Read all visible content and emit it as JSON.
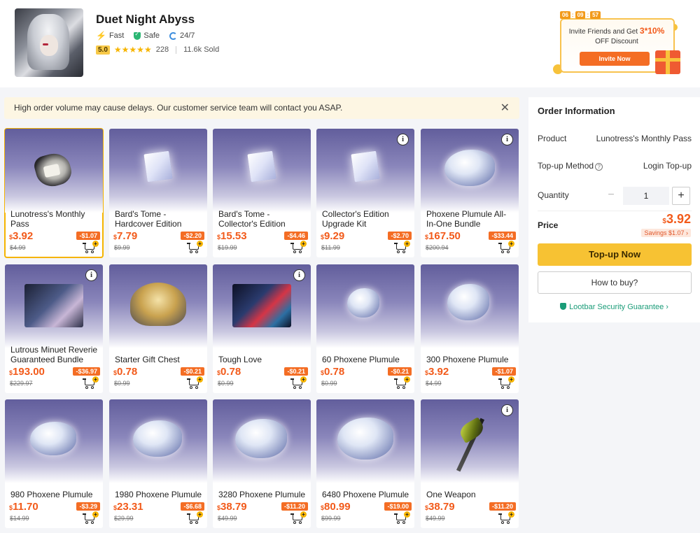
{
  "header": {
    "title": "Duet Night Abyss",
    "features": [
      "Fast",
      "Safe",
      "24/7"
    ],
    "rating": "5.0",
    "stars": "★★★★★",
    "review_count": "228",
    "sold": "11.6k Sold"
  },
  "promo": {
    "timer": [
      "06",
      "09",
      "57"
    ],
    "line1": "Invite Friends and Get",
    "highlight": "3*10%",
    "line2": "OFF Discount",
    "button": "Invite Now"
  },
  "notice": {
    "text": "High order volume may cause delays. Our customer service team will contact you ASAP.",
    "close": "✕"
  },
  "products": [
    {
      "name": "Lunotress's Monthly Pass",
      "price": "3.92",
      "discount": "-$1.07",
      "old_price": "$4.99"
    },
    {
      "name": "Bard's Tome - Hardcover Edition",
      "price": "7.79",
      "discount": "-$2.20",
      "old_price": "$9.99"
    },
    {
      "name": "Bard's Tome - Collector's Edition",
      "price": "15.53",
      "discount": "-$4.46",
      "old_price": "$19.99"
    },
    {
      "name": "Collector's Edition Upgrade Kit",
      "price": "9.29",
      "discount": "-$2.70",
      "old_price": "$11.99"
    },
    {
      "name": "Phoxene Plumule All-In-One Bundle",
      "price": "167.50",
      "discount": "-$33.44",
      "old_price": "$200.94"
    },
    {
      "name": "Lutrous Minuet Reverie Guaranteed Bundle",
      "price": "193.00",
      "discount": "-$36.97",
      "old_price": "$229.97"
    },
    {
      "name": "Starter Gift Chest",
      "price": "0.78",
      "discount": "-$0.21",
      "old_price": "$0.99"
    },
    {
      "name": "Tough Love",
      "price": "0.78",
      "discount": "-$0.21",
      "old_price": "$0.99"
    },
    {
      "name": "60 Phoxene Plumule",
      "price": "0.78",
      "discount": "-$0.21",
      "old_price": "$0.99"
    },
    {
      "name": "300 Phoxene Plumule",
      "price": "3.92",
      "discount": "-$1.07",
      "old_price": "$4.99"
    },
    {
      "name": "980 Phoxene Plumule",
      "price": "11.70",
      "discount": "-$3.29",
      "old_price": "$14.99"
    },
    {
      "name": "1980 Phoxene Plumule",
      "price": "23.31",
      "discount": "-$6.68",
      "old_price": "$29.99"
    },
    {
      "name": "3280 Phoxene Plumule",
      "price": "38.79",
      "discount": "-$11.20",
      "old_price": "$49.99"
    },
    {
      "name": "6480 Phoxene Plumule",
      "price": "80.99",
      "discount": "-$19.00",
      "old_price": "$99.99"
    },
    {
      "name": "One Weapon",
      "price": "38.79",
      "discount": "-$11.20",
      "old_price": "$49.99"
    }
  ],
  "currency_symbol": "$",
  "info_glyph": "i",
  "order": {
    "title": "Order Information",
    "product_label": "Product",
    "product_value": "Lunotress's Monthly Pass",
    "method_label": "Top-up Method",
    "method_value": "Login Top-up",
    "quantity_label": "Quantity",
    "quantity": "1",
    "minus": "−",
    "plus": "+",
    "price_label": "Price",
    "price": "3.92",
    "savings": "Savings $1.07 ›",
    "topup_button": "Top-up Now",
    "howto_button": "How to buy?",
    "guarantee": "Lootbar Security Guarantee ›"
  },
  "colors": {
    "accent_orange": "#f25a1a",
    "button_yellow": "#f7c233",
    "guarantee_green": "#1a9c78",
    "selected_border": "#f5b400"
  }
}
